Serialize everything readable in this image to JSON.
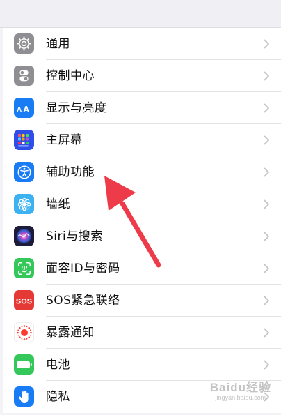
{
  "settings": {
    "items": [
      {
        "label": "通用",
        "icon": "gear-icon",
        "color": "#8e8e93"
      },
      {
        "label": "控制中心",
        "icon": "toggle-icon",
        "color": "#8e8e93"
      },
      {
        "label": "显示与亮度",
        "icon": "text-size-icon",
        "color": "#1a7cf5"
      },
      {
        "label": "主屏幕",
        "icon": "home-grid-icon",
        "color": "#2d4ee8"
      },
      {
        "label": "辅助功能",
        "icon": "accessibility-icon",
        "color": "#1a7cf5"
      },
      {
        "label": "墙纸",
        "icon": "flower-icon",
        "color": "#3cb3f0"
      },
      {
        "label": "Siri与搜索",
        "icon": "siri-icon",
        "color": "#1c1c3a"
      },
      {
        "label": "面容ID与密码",
        "icon": "face-id-icon",
        "color": "#34c759"
      },
      {
        "label": "SOS紧急联络",
        "icon": "sos-icon",
        "color": "#e53935"
      },
      {
        "label": "暴露通知",
        "icon": "exposure-icon",
        "color": "#ffffff"
      },
      {
        "label": "电池",
        "icon": "battery-icon",
        "color": "#34c759"
      },
      {
        "label": "隐私",
        "icon": "hand-icon",
        "color": "#1a7cf5"
      }
    ]
  },
  "annotation": {
    "arrow_color": "#ee3b4a"
  },
  "watermark": {
    "main": "Baidu经验",
    "sub": "jingyan.baidu.com"
  }
}
